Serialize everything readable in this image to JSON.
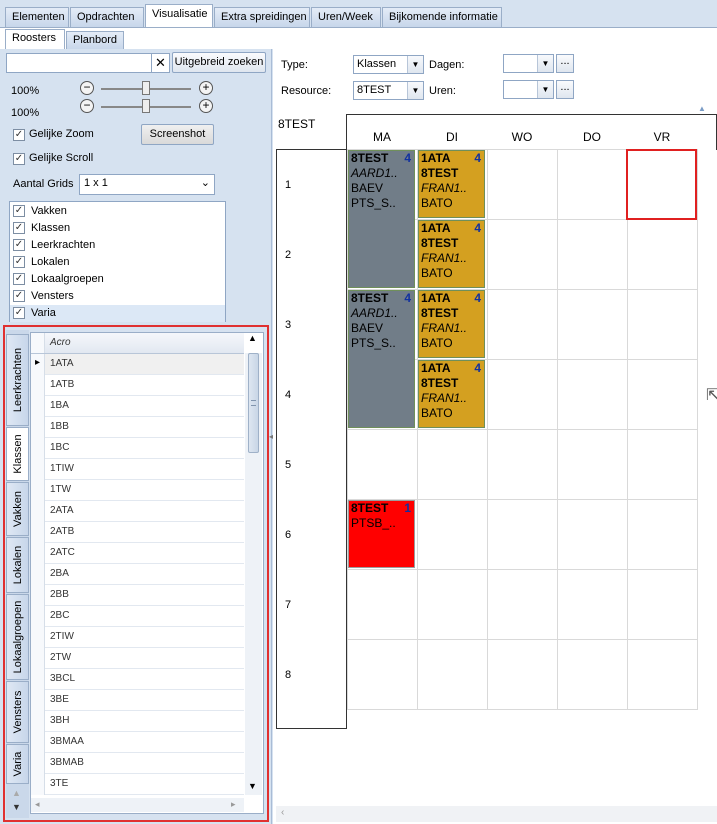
{
  "top_tabs": [
    "Elementen",
    "Opdrachten",
    "Visualisatie",
    "Extra spreidingen",
    "Uren/Week",
    "Bijkomende informatie"
  ],
  "active_top_tab": "Visualisatie",
  "sub_tabs": [
    "Roosters",
    "Planbord"
  ],
  "active_sub_tab": "Roosters",
  "left": {
    "search_value": "",
    "advanced_search_label": "Uitgebreid zoeken",
    "zoom1": "100%",
    "zoom2": "100%",
    "same_zoom_label": "Gelijke Zoom",
    "same_scroll_label": "Gelijke Scroll",
    "screenshot_label": "Screenshot",
    "grids_label": "Aantal Grids",
    "grids_value": "1 x 1",
    "checklist": [
      {
        "label": "Vakken",
        "checked": true
      },
      {
        "label": "Klassen",
        "checked": true
      },
      {
        "label": "Leerkrachten",
        "checked": true
      },
      {
        "label": "Lokalen",
        "checked": true
      },
      {
        "label": "Lokaalgroepen",
        "checked": true
      },
      {
        "label": "Vensters",
        "checked": true
      },
      {
        "label": "Varia",
        "checked": true
      }
    ],
    "vertical_tabs": [
      "Leerkrachten",
      "Klassen",
      "Vakken",
      "Lokalen",
      "Lokaalgroepen",
      "Vensters",
      "Varia"
    ],
    "active_vertical_tab": "Klassen",
    "grid_header": "Acro",
    "rows": [
      "1ATA",
      "1ATB",
      "1BA",
      "1BB",
      "1BC",
      "1TIW",
      "1TW",
      "2ATA",
      "2ATB",
      "2ATC",
      "2BA",
      "2BB",
      "2BC",
      "2TIW",
      "2TW",
      "3BCL",
      "3BE",
      "3BH",
      "3BMAA",
      "3BMAB",
      "3TE"
    ]
  },
  "right": {
    "type_label": "Type:",
    "type_value": "Klassen",
    "days_label": "Dagen:",
    "days_value": "",
    "resource_label": "Resource:",
    "resource_value": "8TEST",
    "hours_label": "Uren:",
    "hours_value": "",
    "dots_label": "...",
    "schedule_title": "8TEST",
    "days": [
      "MA",
      "DI",
      "WO",
      "DO",
      "VR"
    ],
    "hours": [
      "1",
      "2",
      "3",
      "4",
      "5",
      "6",
      "7",
      "8"
    ],
    "lessons": [
      {
        "day": 0,
        "hour": 0,
        "span": 2,
        "color": "gray",
        "l1": "8TEST",
        "count": "4",
        "l2": "AARD1..",
        "l3": "BAEV",
        "l4": "PTS_S.."
      },
      {
        "day": 1,
        "hour": 0,
        "span": 1,
        "color": "gold",
        "l1": "1ATA",
        "count": "4",
        "l2": "8TEST",
        "l3": "FRAN1..",
        "l4": "BATO"
      },
      {
        "day": 1,
        "hour": 1,
        "span": 1,
        "color": "gold",
        "l1": "1ATA",
        "count": "4",
        "l2": "8TEST",
        "l3": "FRAN1..",
        "l4": "BATO"
      },
      {
        "day": 0,
        "hour": 2,
        "span": 2,
        "color": "gray",
        "l1": "8TEST",
        "count": "4",
        "l2": "AARD1..",
        "l3": "BAEV",
        "l4": "PTS_S.."
      },
      {
        "day": 1,
        "hour": 2,
        "span": 1,
        "color": "gold",
        "l1": "1ATA",
        "count": "4",
        "l2": "8TEST",
        "l3": "FRAN1..",
        "l4": "BATO"
      },
      {
        "day": 1,
        "hour": 3,
        "span": 1,
        "color": "gold",
        "l1": "1ATA",
        "count": "4",
        "l2": "8TEST",
        "l3": "FRAN1..",
        "l4": "BATO"
      },
      {
        "day": 0,
        "hour": 5,
        "span": 1,
        "color": "red",
        "l1": "8TEST",
        "count": "1",
        "l2": "PTSB_..",
        "l3": "",
        "l4": ""
      }
    ]
  }
}
